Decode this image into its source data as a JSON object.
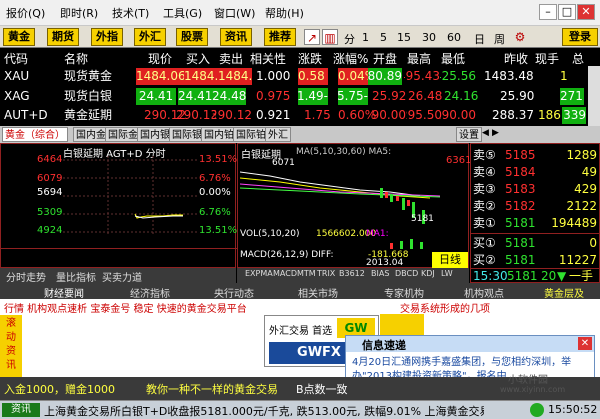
{
  "menu": {
    "items": [
      "报价(Q)",
      "即时(R)",
      "技术(T)",
      "工具(G)",
      "窗口(W)",
      "帮助(H)"
    ]
  },
  "toolbar": {
    "buttons": [
      "黄金",
      "期货",
      "外指",
      "外汇",
      "股票",
      "资讯",
      "推荐"
    ],
    "periods": [
      "分",
      "1",
      "5",
      "15",
      "30",
      "60",
      "日",
      "周"
    ],
    "login": "登录"
  },
  "quote": {
    "headers": [
      "代码",
      "名称",
      "现价",
      "买入",
      "卖出",
      "相关性",
      "涨跌",
      "涨幅%",
      "开盘",
      "最高",
      "最低",
      "昨收",
      "现手",
      "总"
    ],
    "rows": [
      {
        "code": "XAU",
        "name": "现货黄金",
        "price": "1484.06",
        "bid": "1484.06",
        "ask": "1484.56",
        "corr": "1.000",
        "chg": "0.58",
        "pct": "0.04%",
        "open": "1480.89",
        "high": "1495.43",
        "low": "1425.56",
        "prev": "1483.48",
        "vol": "1",
        "total": ""
      },
      {
        "code": "XAG",
        "name": "现货白银",
        "price": "24.41",
        "bid": "24.41",
        "ask": "24.48",
        "corr": "0.975",
        "chg": "-1.49",
        "pct": "-5.75",
        "open": "25.92",
        "high": "26.48",
        "low": "24.16",
        "prev": "25.90",
        "vol": "271",
        "total": ""
      },
      {
        "code": "AUT+D",
        "name": "黄金延期",
        "price": "290.12",
        "bid": "290.13",
        "ask": "290.12",
        "corr": "0.921",
        "chg": "1.75",
        "pct": "0.60%",
        "open": "290.00",
        "high": "295.50",
        "low": "290.00",
        "prev": "288.37",
        "vol": "186",
        "total": "339"
      }
    ]
  },
  "subtabs": [
    "黄金（综合）",
    "国内金",
    "国际金",
    "国内银",
    "国际银",
    "国内铂",
    "国际铂",
    "外汇"
  ],
  "settings": "设置",
  "chart1": {
    "title": "白银延期 AGT+D 分时",
    "left_ticks": [
      "6464",
      "6079",
      "5694",
      "5309",
      "4924"
    ],
    "right_ticks": [
      "13.51%",
      "6.76%",
      "0.00%",
      "6.76%",
      "13.51%"
    ],
    "tabs": [
      "分时走势",
      "量比指标",
      "买卖力道"
    ]
  },
  "chart2": {
    "title": "白银延期",
    "ma_label": "MA(5,10,30,60) MA5:",
    "right_tick": "6361",
    "price_marker": "6071",
    "low_marker": "5181",
    "vol_label": "VOL(5,10,20)",
    "vol_val": "1566602.000",
    "vol_ma": "MA1:",
    "macd_label": "MACD(26,12,9) DIFF:",
    "macd_val": "-181.668",
    "date": "2013.04",
    "period": "日线",
    "tabs": [
      "EXPMA",
      "MACD",
      "MTM",
      "TRIX",
      "B3612",
      "BIAS",
      "DBCD",
      "KDJ",
      "LW"
    ]
  },
  "orderbook": {
    "asks": [
      {
        "l": "卖⑤",
        "p": "5185",
        "v": "1289"
      },
      {
        "l": "卖④",
        "p": "5184",
        "v": "49"
      },
      {
        "l": "卖③",
        "p": "5183",
        "v": "429"
      },
      {
        "l": "卖②",
        "p": "5182",
        "v": "2122"
      },
      {
        "l": "卖①",
        "p": "5181",
        "v": "194489"
      }
    ],
    "bids": [
      {
        "l": "买①",
        "p": "5181",
        "v": "0"
      },
      {
        "l": "买②",
        "p": "5181",
        "v": "11227"
      }
    ],
    "foot": {
      "time": "15:30",
      "price": "5181",
      "chg": "20",
      "tag": "一手"
    }
  },
  "news": {
    "tabs": [
      "财经要闻",
      "经济指标",
      "央行动态",
      "相关市场",
      "专家机构",
      "机构观点",
      "黄金层及"
    ],
    "ticker": "行情 机构观点速析   宝泰金号 稳定 快速的黄金交易平台",
    "ticker2": "交易系统形成的几项",
    "side": [
      "滚",
      "动",
      "资",
      "讯"
    ],
    "bottom_left": "入金1000，赠金1000",
    "bottom_mid": "教你一种不一样的黄金交易",
    "bottom_right": "B点数一致",
    "ad_top": "外汇交易 首选",
    "ad_brand": "GWFX",
    "ad_logo": "GWFX",
    "popup_title": "信息速递",
    "popup_text": "4月20日汇通网携手嘉盛集团，与您相约深圳，举办\"2013构建投资新策略\"，报名中"
  },
  "status": {
    "icon": "资讯",
    "text": "上海黄金交易所白银T+D收盘报5181.000元/千克, 跌513.00元, 跌幅9.01%   上海黄金交易所",
    "clock": "15:50:52",
    "watermark": "小软件园",
    "sub": "www.xiyinn.com"
  }
}
